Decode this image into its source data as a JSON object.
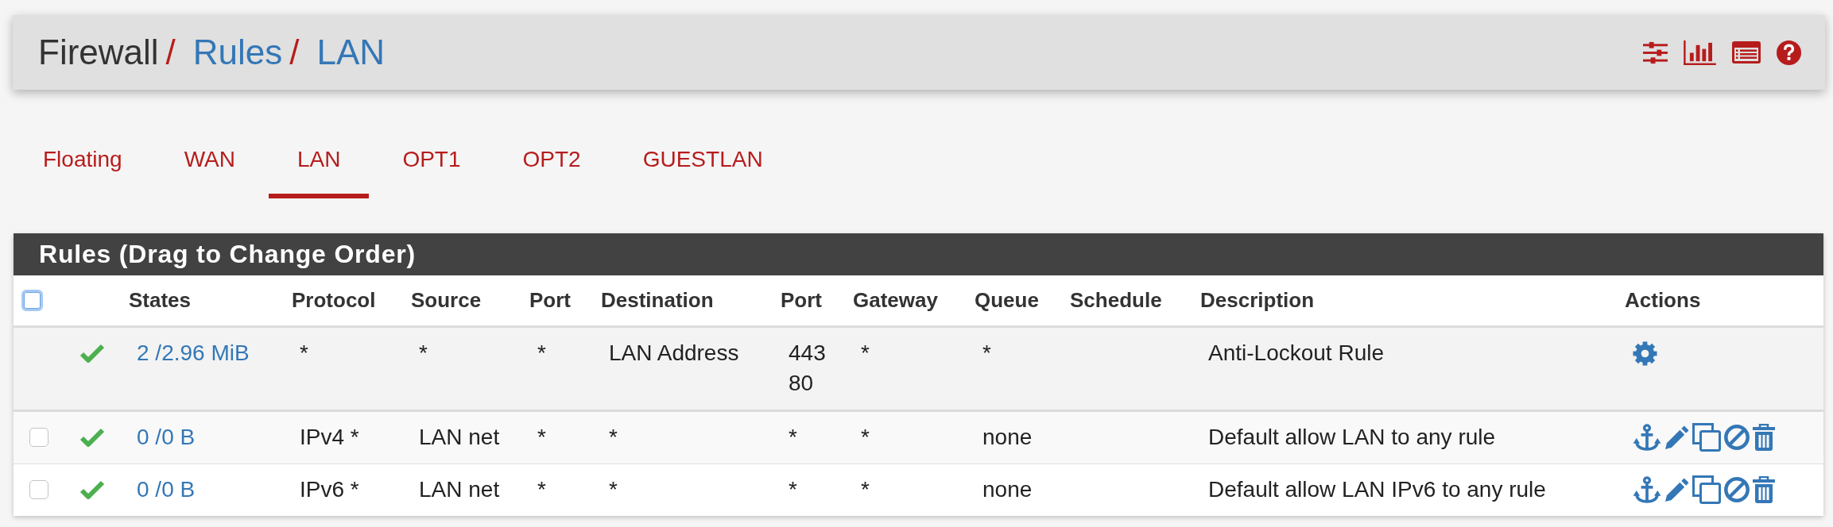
{
  "header": {
    "breadcrumb": [
      {
        "kind": "text",
        "label": "Firewall"
      },
      {
        "kind": "separator",
        "label": "/"
      },
      {
        "kind": "link",
        "label": "Rules"
      },
      {
        "kind": "separator",
        "label": "/"
      },
      {
        "kind": "link",
        "label": "LAN"
      }
    ]
  },
  "tabs": [
    {
      "label": "Floating",
      "selected": false
    },
    {
      "label": "WAN",
      "selected": false
    },
    {
      "label": "LAN",
      "selected": true
    },
    {
      "label": "OPT1",
      "selected": false
    },
    {
      "label": "OPT2",
      "selected": false
    },
    {
      "label": "GUESTLAN",
      "selected": false
    }
  ],
  "rules_panel": {
    "title": "Rules (Drag to Change Order)",
    "select_all": {
      "checked": false
    },
    "columns": [
      "States",
      "Protocol",
      "Source",
      "Port",
      "Destination",
      "Port",
      "Gateway",
      "Queue",
      "Schedule",
      "Description",
      "Actions"
    ],
    "rows": [
      {
        "kind": "anti-lockout",
        "enabled": true,
        "states": "2 /2.96 MiB",
        "protocol": "*",
        "source": "*",
        "source_port": "*",
        "destination": "LAN Address",
        "destination_port": [
          "443",
          "80"
        ],
        "gateway": "*",
        "queue": "*",
        "description": "Anti-Lockout Rule"
      },
      {
        "kind": "user",
        "checked": false,
        "enabled": true,
        "states": "0 /0 B",
        "protocol": "IPv4 *",
        "source": "LAN net",
        "source_port": "*",
        "destination": "*",
        "destination_port": [
          "*"
        ],
        "gateway": "*",
        "queue": "none",
        "description": "Default allow LAN to any rule"
      },
      {
        "kind": "user",
        "checked": false,
        "enabled": true,
        "states": "0 /0 B",
        "protocol": "IPv6 *",
        "source": "LAN net",
        "source_port": "*",
        "destination": "*",
        "destination_port": [
          "*"
        ],
        "gateway": "*",
        "queue": "none",
        "description": "Default allow LAN IPv6 to any rule"
      }
    ]
  }
}
